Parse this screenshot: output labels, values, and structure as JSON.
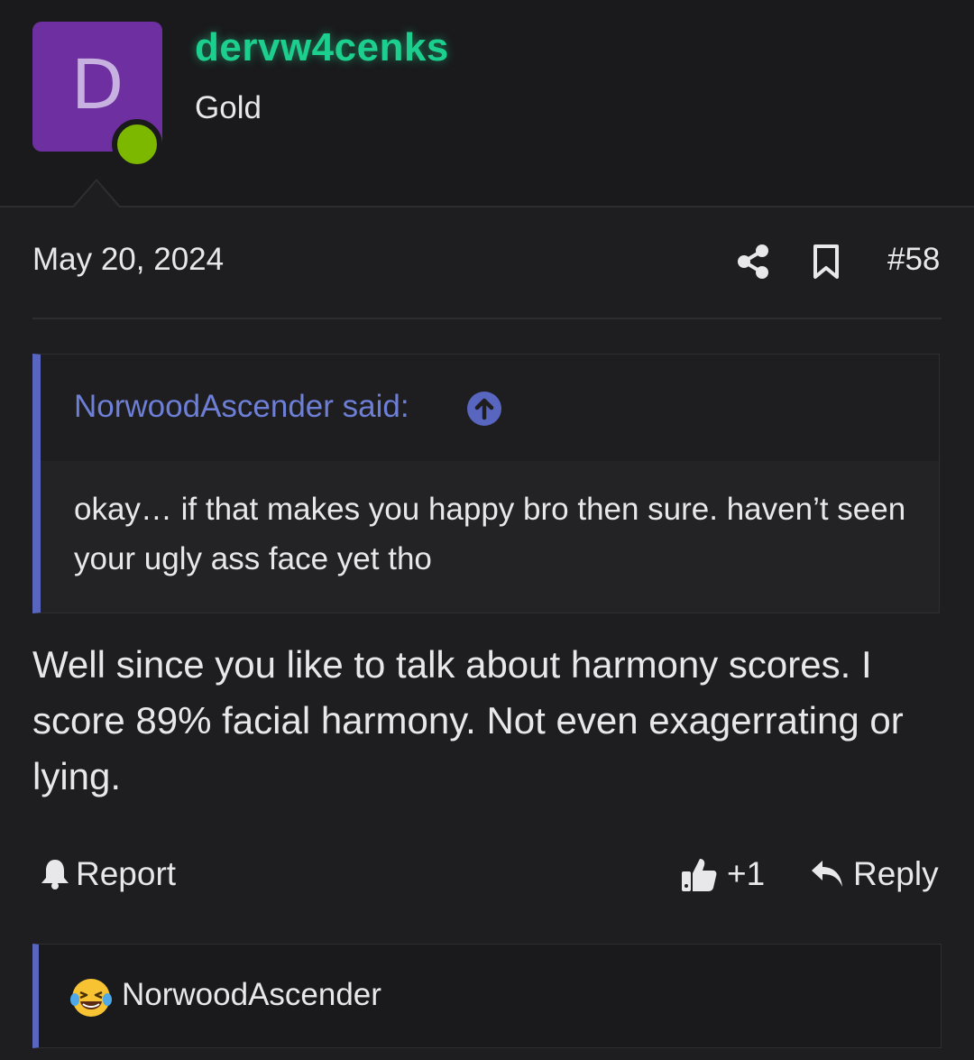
{
  "user": {
    "avatar_letter": "D",
    "avatar_color": "#6e2fa0",
    "online_color": "#7cb800",
    "name": "dervw4cenks",
    "name_color": "#1dcf8e",
    "rank": "Gold"
  },
  "post": {
    "date": "May 20, 2024",
    "number": "#58",
    "icons": [
      "share-icon",
      "bookmark-icon"
    ],
    "quote": {
      "author": "NorwoodAscender said:",
      "text": "okay… if that makes you happy bro then sure. haven’t seen your ugly ass face yet tho",
      "accent_color": "#5966c0"
    },
    "body": "Well since you like to talk about harmony scores. I score 89% facial harmony. Not even exagerrating or lying."
  },
  "actions": {
    "report": "Report",
    "reaction_count": "+1",
    "reply": "Reply"
  },
  "reactions": {
    "emoji": "laughing-crying-emoji",
    "users": "NorwoodAscender"
  }
}
